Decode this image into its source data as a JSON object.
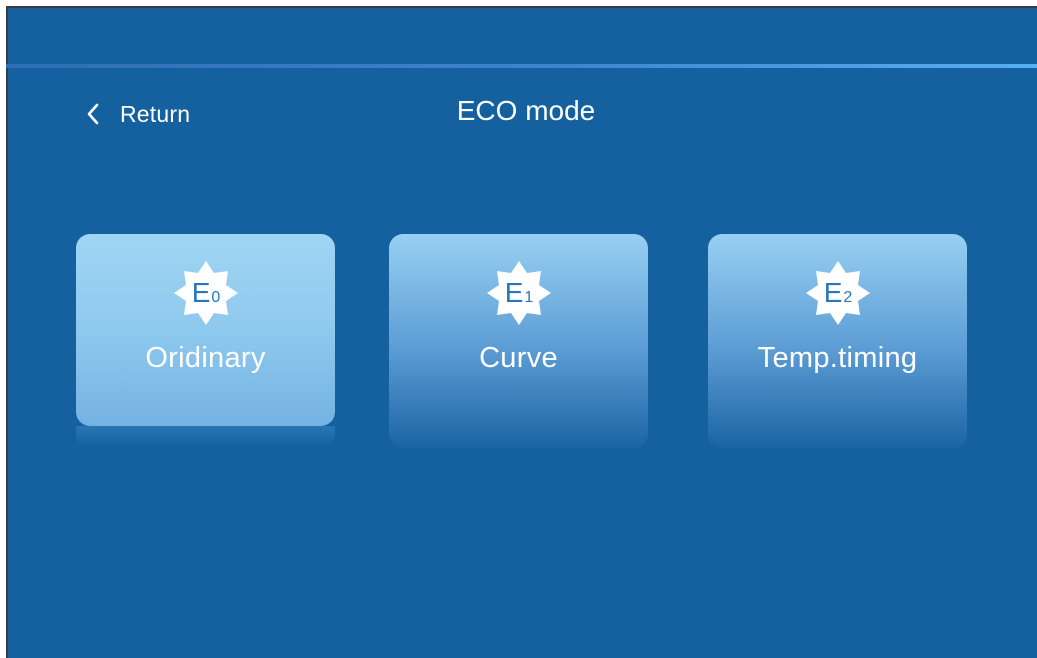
{
  "header": {
    "back_label": "Return",
    "title": "ECO mode"
  },
  "modes": [
    {
      "badge_letter": "E",
      "badge_sub": "0",
      "label": "Oridinary",
      "selected": true
    },
    {
      "badge_letter": "E",
      "badge_sub": "1",
      "label": "Curve",
      "selected": false
    },
    {
      "badge_letter": "E",
      "badge_sub": "2",
      "label": "Temp.timing",
      "selected": false
    }
  ],
  "colors": {
    "background": "#1561a0",
    "badge_text": "#2677c0"
  }
}
